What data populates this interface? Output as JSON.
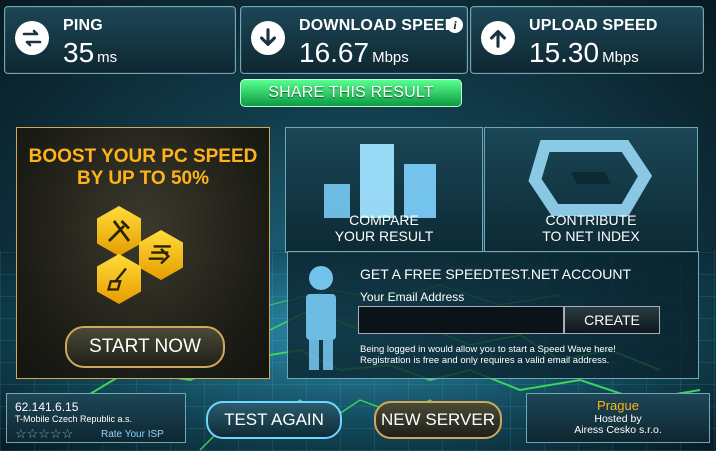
{
  "header": {
    "ping": {
      "label": "PING",
      "value": "35",
      "unit": "ms"
    },
    "download": {
      "label": "DOWNLOAD SPEED",
      "value": "16.67",
      "unit": "Mbps"
    },
    "upload": {
      "label": "UPLOAD SPEED",
      "value": "15.30",
      "unit": "Mbps"
    }
  },
  "share_label": "SHARE THIS RESULT",
  "boost": {
    "title_line1": "BOOST YOUR PC SPEED",
    "title_line2": "BY UP TO 50%",
    "start_label": "START NOW"
  },
  "tiles": {
    "compare_line1": "COMPARE",
    "compare_line2": "YOUR RESULT",
    "contribute_line1": "CONTRIBUTE",
    "contribute_line2": "TO NET INDEX"
  },
  "account": {
    "title": "GET A FREE SPEEDTEST.NET ACCOUNT",
    "email_label": "Your Email Address",
    "email_value": "",
    "create_label": "CREATE",
    "note_line1": "Being logged in would allow you to start a Speed Wave here!",
    "note_line2": "Registration is free and only requires a valid email address."
  },
  "footer": {
    "ip": "62.141.6.15",
    "isp": "T-Mobile Czech Republic a.s.",
    "stars": "☆☆☆☆☆",
    "rate_label": "Rate Your ISP",
    "test_again_label": "TEST AGAIN",
    "new_server_label": "NEW SERVER",
    "server_city": "Prague",
    "hosted_by": "Hosted by",
    "host_name": "Airess Cesko s.r.o."
  },
  "colors": {
    "accent_green": "#1fcf63",
    "accent_gold": "#ffb31a",
    "accent_cyan": "#6fd7ff"
  }
}
